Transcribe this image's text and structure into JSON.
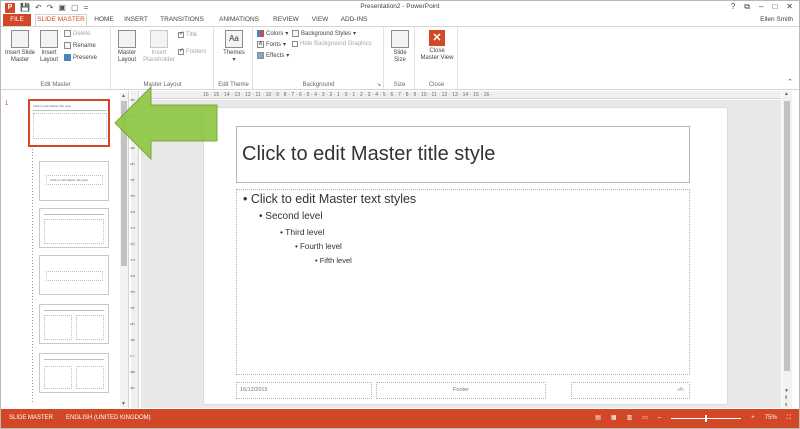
{
  "titlebar": {
    "app_logo": "P",
    "qat": [
      "save-icon",
      "undo-icon",
      "redo-icon",
      "present-icon",
      "new-icon"
    ],
    "qat_glyphs": [
      "💾",
      "↶",
      "↷",
      "▣",
      "▢",
      "="
    ],
    "doc_title": "Presentation2 - PowerPoint",
    "help": "?",
    "restore": "⧉",
    "minimize": "–",
    "maximize": "□",
    "close": "✕"
  },
  "tabs": [
    {
      "label": "FILE"
    },
    {
      "label": "SLIDE MASTER"
    },
    {
      "label": "HOME"
    },
    {
      "label": "INSERT"
    },
    {
      "label": "TRANSITIONS"
    },
    {
      "label": "ANIMATIONS"
    },
    {
      "label": "REVIEW"
    },
    {
      "label": "VIEW"
    },
    {
      "label": "ADD-INS"
    }
  ],
  "user": "Ellen Smith",
  "ribbon": {
    "edit_master": {
      "label": "Edit Master",
      "insert_slide_master": [
        "Insert Slide",
        "Master"
      ],
      "insert_layout": [
        "Insert",
        "Layout"
      ],
      "delete": "Delete",
      "rename": "Rename",
      "preserve": "Preserve"
    },
    "master_layout": {
      "label": "Master Layout",
      "master_layout_btn": [
        "Master",
        "Layout"
      ],
      "insert_placeholder": [
        "Insert",
        "Placeholder"
      ],
      "title": "Title",
      "footers": "Footers"
    },
    "edit_theme": {
      "label": "Edit Theme",
      "themes": "Themes"
    },
    "background": {
      "label": "Background",
      "colors": "Colors",
      "fonts": "Fonts",
      "effects": "Effects",
      "background_styles": "Background Styles",
      "hide_bg": "Hide Background Graphics"
    },
    "size": {
      "label": "Size",
      "slide_size": [
        "Slide",
        "Size"
      ]
    },
    "close": {
      "label": "Close",
      "close_master": [
        "Close",
        "Master View"
      ]
    }
  },
  "thumbs": {
    "first_num": "1",
    "master_title": "Click to edit Master title style",
    "layout_title": "Click to edit Master title style"
  },
  "hruler_text": "16 · 15 · 14 · 13 · 12 · 11 · 10 · 9 · 8 · 7 · 6 · 5 · 4 · 3 · 2 · 1 · 0 · 1 · 2 · 3 · 4 · 5 · 6 · 7 · 8 · 9 · 10 · 11 · 12 · 13 · 14 · 15 · 16 ·",
  "vruler_marks": [
    "9",
    "8",
    "7",
    "6",
    "5",
    "4",
    "3",
    "2",
    "1",
    "0",
    "1",
    "2",
    "3",
    "4",
    "5",
    "6",
    "7",
    "8",
    "9"
  ],
  "slide": {
    "title": "Click to edit Master title style",
    "level1": "• Click to edit Master text styles",
    "level2": "• Second level",
    "level3": "• Third level",
    "level4": "• Fourth level",
    "level5": "• Fifth level",
    "date": "16/12/2015",
    "footer": "Footer",
    "num": "‹#›"
  },
  "status": {
    "mode": "SLIDE MASTER",
    "language": "ENGLISH (UNITED KINGDOM)",
    "zoom": "75%",
    "zoom_minus": "–",
    "zoom_plus": "+"
  },
  "colors": {
    "accent": "#d24726",
    "arrow": "#8dc63f"
  }
}
